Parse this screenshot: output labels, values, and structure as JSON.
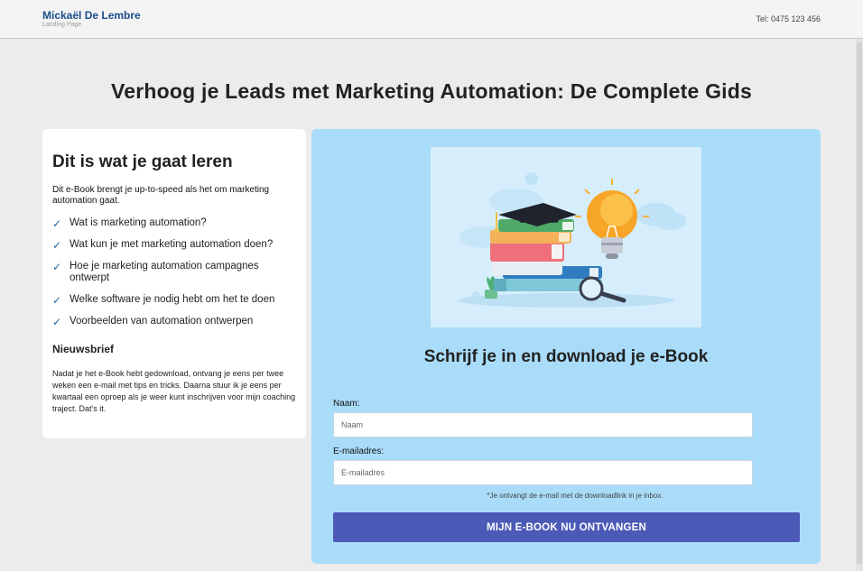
{
  "header": {
    "brand_name": "Mickaël De Lembre",
    "brand_subtitle": "Landing Page",
    "phone": "Tel: 0475 123 456"
  },
  "page": {
    "headline": "Verhoog je Leads met Marketing Automation: De Complete Gids"
  },
  "learn": {
    "title": "Dit is wat je gaat leren",
    "intro": "Dit e-Book brengt je up-to-speed als het om marketing automation gaat.",
    "items": [
      "Wat is marketing automation?",
      "Wat kun je met marketing automation doen?",
      "Hoe je marketing automation campagnes ontwerpt",
      "Welke software je nodig hebt om het te doen",
      "Voorbeelden van automation ontwerpen"
    ],
    "newsletter_title": "Nieuwsbrief",
    "newsletter_text": "Nadat je het e-Book hebt gedownload, ontvang je eens per twee weken een e-mail met tips en tricks. Daarna stuur ik je eens per kwartaal een oproep als je weer kunt inschrijven voor mijn coaching traject. Dat's it."
  },
  "form": {
    "title": "Schrijf je in en download je e-Book",
    "name_label": "Naam:",
    "name_placeholder": "Naam",
    "name_value": "",
    "email_label": "E-mailadres:",
    "email_placeholder": "E-mailadres",
    "email_value": "",
    "note": "*Je ontvangt de e-mail met de downloadlink in je inbox.",
    "submit_label": "MIJN E-BOOK NU ONTVANGEN"
  },
  "icons": {
    "check": "check-icon",
    "illustration": "books-graduation-cap-lightbulb-illustration"
  },
  "colors": {
    "brand": "#1b4f8a",
    "form_background": "#a9dcf9",
    "button": "#4b5ab7",
    "check": "#2266aa"
  }
}
